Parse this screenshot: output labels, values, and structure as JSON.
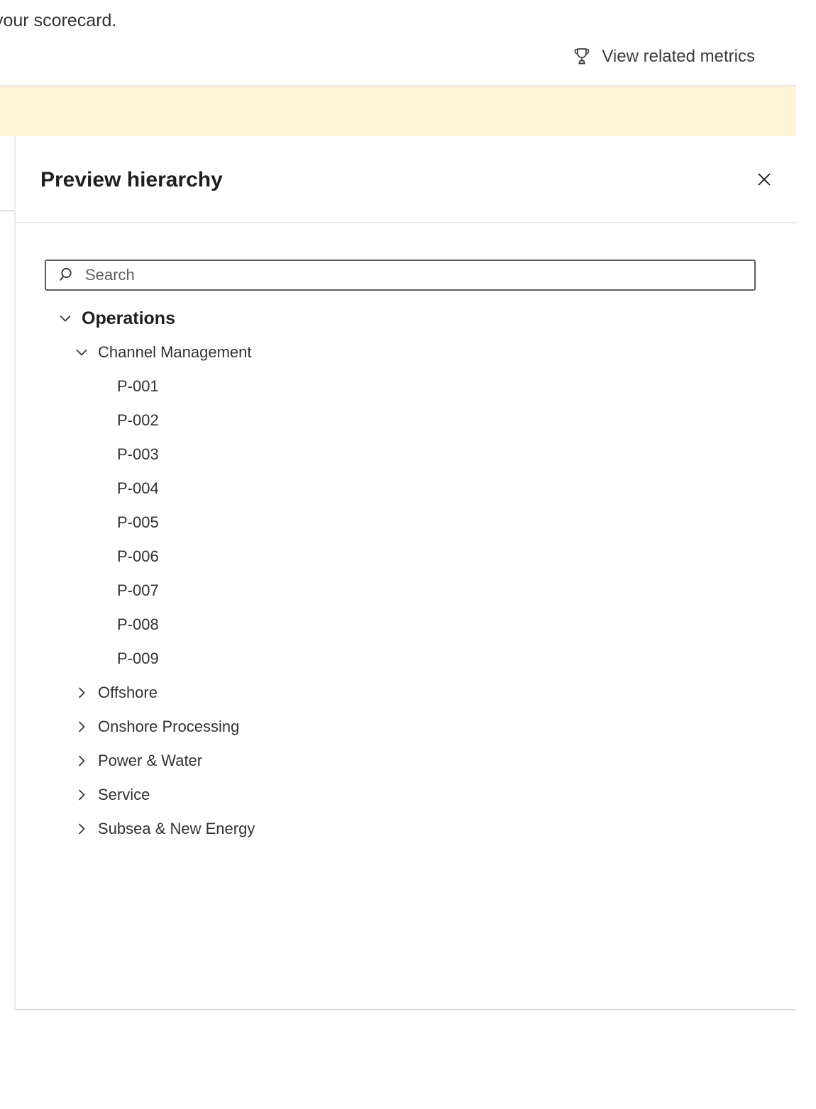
{
  "background": {
    "scorecard_text": "your scorecard.",
    "related_metrics": {
      "label": "View related metrics",
      "icon": "trophy-icon"
    },
    "banner": {
      "text": "",
      "color": "#fdf3d5"
    }
  },
  "panel": {
    "title": "Preview hierarchy",
    "close_icon": "close-icon",
    "search": {
      "placeholder": "Search",
      "value": "",
      "icon": "search-icon"
    },
    "tree": [
      {
        "label": "Operations",
        "level": 0,
        "state": "expanded",
        "icon": "chevron-down-icon"
      },
      {
        "label": "Channel Management",
        "level": 1,
        "state": "expanded",
        "icon": "chevron-down-icon"
      },
      {
        "label": "P-001",
        "level": 2,
        "state": "leaf",
        "icon": ""
      },
      {
        "label": "P-002",
        "level": 2,
        "state": "leaf",
        "icon": ""
      },
      {
        "label": "P-003",
        "level": 2,
        "state": "leaf",
        "icon": ""
      },
      {
        "label": "P-004",
        "level": 2,
        "state": "leaf",
        "icon": ""
      },
      {
        "label": "P-005",
        "level": 2,
        "state": "leaf",
        "icon": ""
      },
      {
        "label": "P-006",
        "level": 2,
        "state": "leaf",
        "icon": ""
      },
      {
        "label": "P-007",
        "level": 2,
        "state": "leaf",
        "icon": ""
      },
      {
        "label": "P-008",
        "level": 2,
        "state": "leaf",
        "icon": ""
      },
      {
        "label": "P-009",
        "level": 2,
        "state": "leaf",
        "icon": ""
      },
      {
        "label": "Offshore",
        "level": 1,
        "state": "collapsed",
        "icon": "chevron-right-icon"
      },
      {
        "label": "Onshore Processing",
        "level": 1,
        "state": "collapsed",
        "icon": "chevron-right-icon"
      },
      {
        "label": "Power & Water",
        "level": 1,
        "state": "collapsed",
        "icon": "chevron-right-icon"
      },
      {
        "label": "Service",
        "level": 1,
        "state": "collapsed",
        "icon": "chevron-right-icon"
      },
      {
        "label": "Subsea & New Energy",
        "level": 1,
        "state": "collapsed",
        "icon": "chevron-right-icon"
      }
    ]
  },
  "colors": {
    "banner_yellow": "#fdf3d5",
    "text_primary": "#323130",
    "text_heading": "#201f1e",
    "border": "#605e5c",
    "divider": "#ebe9e7"
  }
}
